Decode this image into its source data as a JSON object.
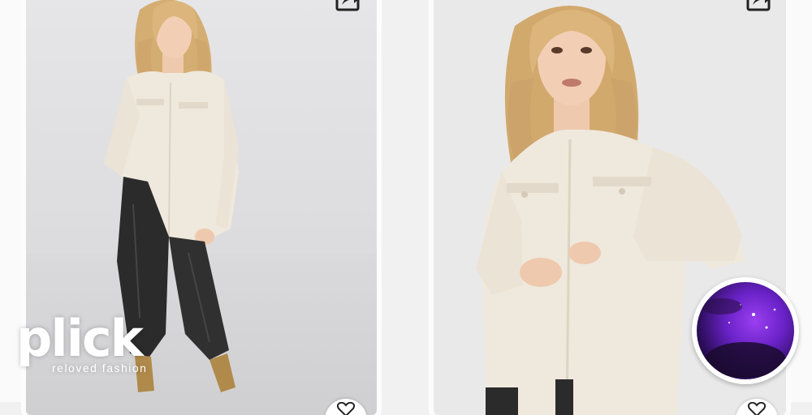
{
  "branding": {
    "logo_text": "plick",
    "tagline": "reloved fashion"
  },
  "cards": [
    {
      "image": "model-full-body",
      "share_icon": "share-icon",
      "favorite_icon": "heart-icon"
    },
    {
      "image": "model-close-up",
      "share_icon": "share-icon",
      "favorite_icon": "heart-icon"
    }
  ],
  "overlay": {
    "avatar_icon": "user-avatar"
  },
  "colors": {
    "shirt": "#efe8dc",
    "pants": "#2b2b2b",
    "hair": "#d7b27a",
    "background": "#f1f1f1"
  }
}
